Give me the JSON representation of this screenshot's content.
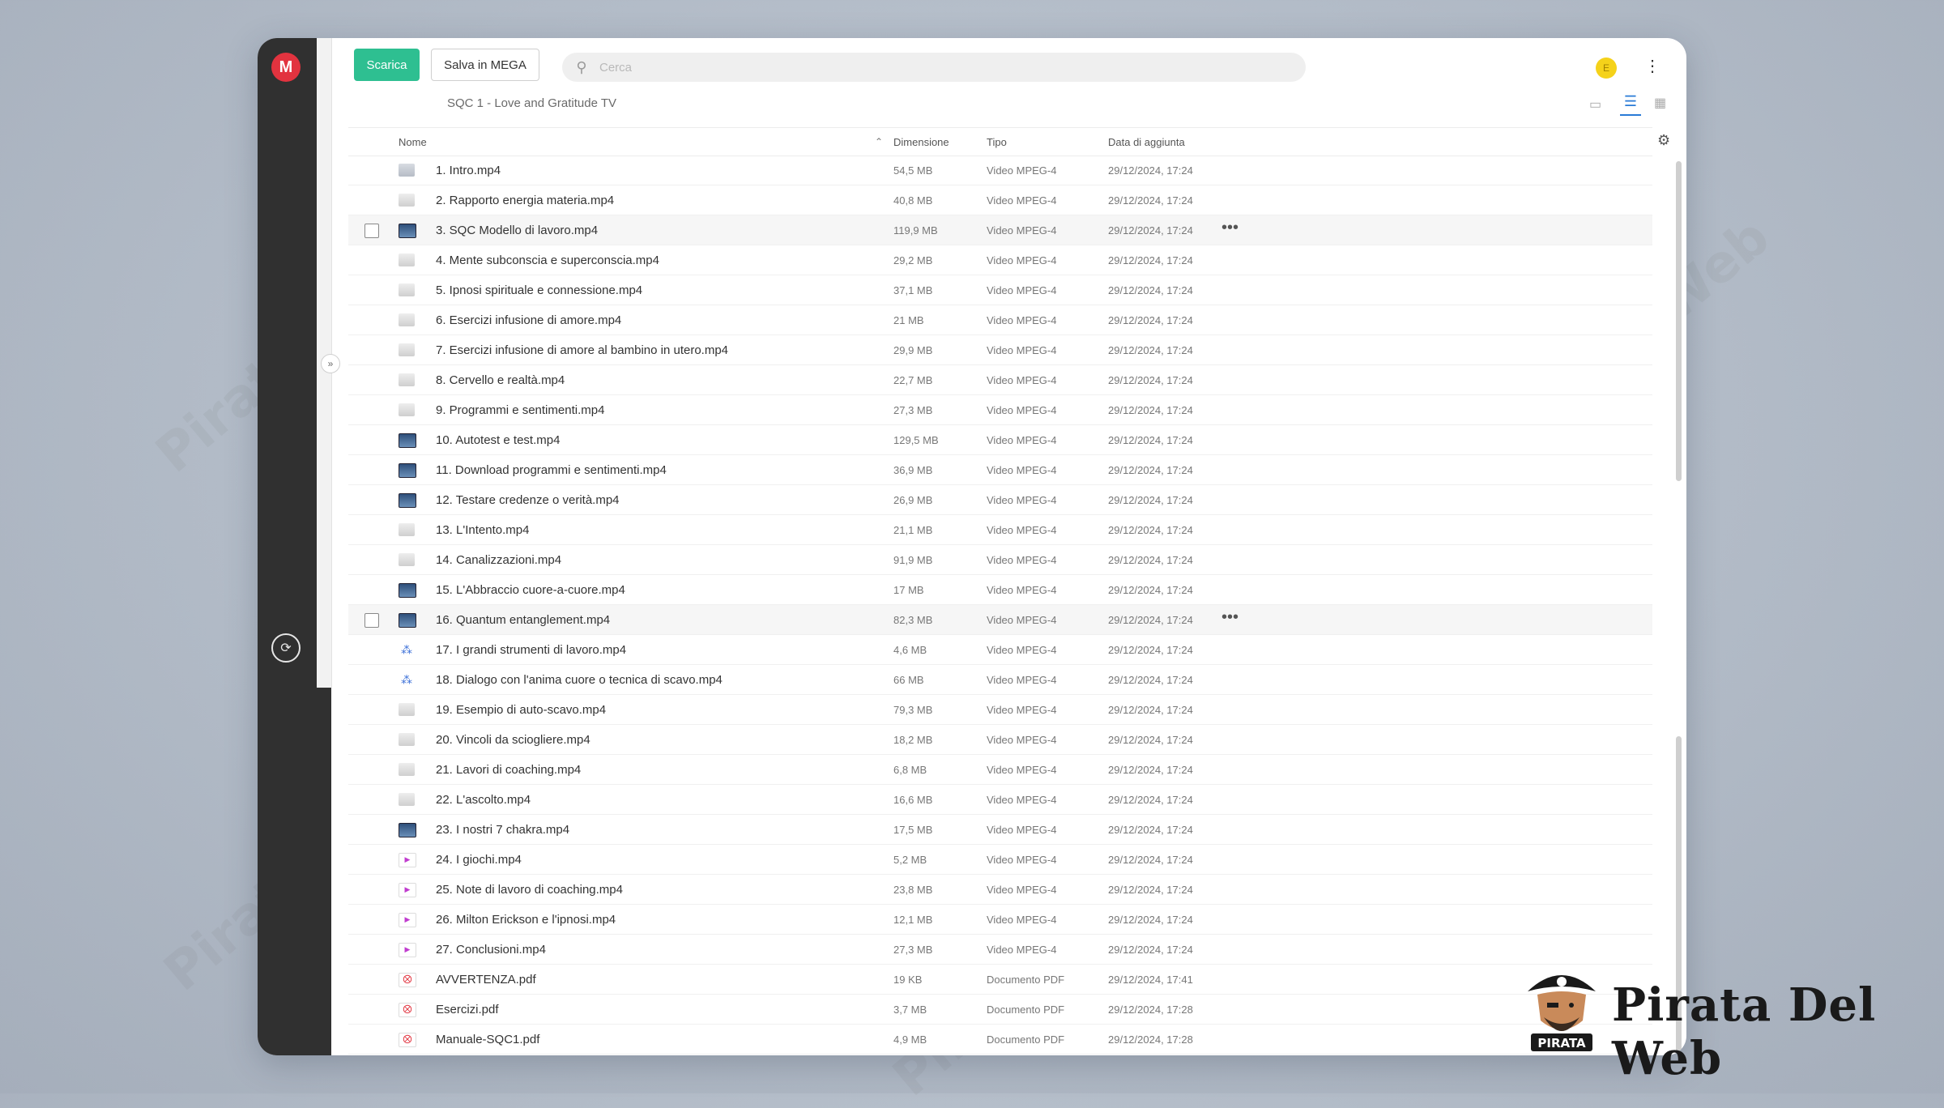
{
  "toolbar": {
    "download_label": "Scarica",
    "save_label": "Salva in MEGA",
    "search_placeholder": "Cerca",
    "avatar_initial": "E"
  },
  "breadcrumb": "SQC 1 - Love and Gratitude TV",
  "table": {
    "headers": {
      "name": "Nome",
      "size": "Dimensione",
      "type": "Tipo",
      "date": "Data di aggiunta"
    },
    "rows": [
      {
        "name": "1. Intro.mp4",
        "size": "54,5 MB",
        "type": "Video MPEG-4",
        "date": "29/12/2024, 17:24",
        "thumb": "t-video"
      },
      {
        "name": "2. Rapporto energia materia.mp4",
        "size": "40,8 MB",
        "type": "Video MPEG-4",
        "date": "29/12/2024, 17:24",
        "thumb": "t-light"
      },
      {
        "name": "3. SQC Modello di lavoro.mp4",
        "size": "119,9 MB",
        "type": "Video MPEG-4",
        "date": "29/12/2024, 17:24",
        "thumb": "t-dark",
        "hover": true
      },
      {
        "name": "4. Mente subconscia e superconscia.mp4",
        "size": "29,2 MB",
        "type": "Video MPEG-4",
        "date": "29/12/2024, 17:24",
        "thumb": "t-light"
      },
      {
        "name": "5. Ipnosi spirituale e connessione.mp4",
        "size": "37,1 MB",
        "type": "Video MPEG-4",
        "date": "29/12/2024, 17:24",
        "thumb": "t-light"
      },
      {
        "name": "6. Esercizi infusione di amore.mp4",
        "size": "21 MB",
        "type": "Video MPEG-4",
        "date": "29/12/2024, 17:24",
        "thumb": "t-light"
      },
      {
        "name": "7. Esercizi infusione di amore al bambino in utero.mp4",
        "size": "29,9 MB",
        "type": "Video MPEG-4",
        "date": "29/12/2024, 17:24",
        "thumb": "t-light"
      },
      {
        "name": "8. Cervello e realtà.mp4",
        "size": "22,7 MB",
        "type": "Video MPEG-4",
        "date": "29/12/2024, 17:24",
        "thumb": "t-light"
      },
      {
        "name": "9. Programmi e sentimenti.mp4",
        "size": "27,3 MB",
        "type": "Video MPEG-4",
        "date": "29/12/2024, 17:24",
        "thumb": "t-light"
      },
      {
        "name": "10. Autotest e test.mp4",
        "size": "129,5 MB",
        "type": "Video MPEG-4",
        "date": "29/12/2024, 17:24",
        "thumb": "t-dark"
      },
      {
        "name": "11. Download programmi e sentimenti.mp4",
        "size": "36,9 MB",
        "type": "Video MPEG-4",
        "date": "29/12/2024, 17:24",
        "thumb": "t-dark"
      },
      {
        "name": "12. Testare credenze o verità.mp4",
        "size": "26,9 MB",
        "type": "Video MPEG-4",
        "date": "29/12/2024, 17:24",
        "thumb": "t-dark"
      },
      {
        "name": "13. L'Intento.mp4",
        "size": "21,1 MB",
        "type": "Video MPEG-4",
        "date": "29/12/2024, 17:24",
        "thumb": "t-light"
      },
      {
        "name": "14. Canalizzazioni.mp4",
        "size": "91,9 MB",
        "type": "Video MPEG-4",
        "date": "29/12/2024, 17:24",
        "thumb": "t-light"
      },
      {
        "name": "15. L'Abbraccio cuore-a-cuore.mp4",
        "size": "17 MB",
        "type": "Video MPEG-4",
        "date": "29/12/2024, 17:24",
        "thumb": "t-dark"
      },
      {
        "name": "16. Quantum entanglement.mp4",
        "size": "82,3 MB",
        "type": "Video MPEG-4",
        "date": "29/12/2024, 17:24",
        "thumb": "t-dark",
        "hover": true
      },
      {
        "name": "17. I grandi strumenti di lavoro.mp4",
        "size": "4,6 MB",
        "type": "Video MPEG-4",
        "date": "29/12/2024, 17:24",
        "thumb": "t-net"
      },
      {
        "name": "18. Dialogo con l'anima cuore o tecnica di scavo.mp4",
        "size": "66 MB",
        "type": "Video MPEG-4",
        "date": "29/12/2024, 17:24",
        "thumb": "t-net"
      },
      {
        "name": "19. Esempio di auto-scavo.mp4",
        "size": "79,3 MB",
        "type": "Video MPEG-4",
        "date": "29/12/2024, 17:24",
        "thumb": "t-light"
      },
      {
        "name": "20. Vincoli da sciogliere.mp4",
        "size": "18,2 MB",
        "type": "Video MPEG-4",
        "date": "29/12/2024, 17:24",
        "thumb": "t-light"
      },
      {
        "name": "21. Lavori di coaching.mp4",
        "size": "6,8 MB",
        "type": "Video MPEG-4",
        "date": "29/12/2024, 17:24",
        "thumb": "t-light"
      },
      {
        "name": "22. L'ascolto.mp4",
        "size": "16,6 MB",
        "type": "Video MPEG-4",
        "date": "29/12/2024, 17:24",
        "thumb": "t-light"
      },
      {
        "name": "23. I nostri 7 chakra.mp4",
        "size": "17,5 MB",
        "type": "Video MPEG-4",
        "date": "29/12/2024, 17:24",
        "thumb": "t-dark"
      },
      {
        "name": "24. I giochi.mp4",
        "size": "5,2 MB",
        "type": "Video MPEG-4",
        "date": "29/12/2024, 17:24",
        "thumb": "t-mp4"
      },
      {
        "name": "25. Note di lavoro di coaching.mp4",
        "size": "23,8 MB",
        "type": "Video MPEG-4",
        "date": "29/12/2024, 17:24",
        "thumb": "t-mp4"
      },
      {
        "name": "26. Milton Erickson e l'ipnosi.mp4",
        "size": "12,1 MB",
        "type": "Video MPEG-4",
        "date": "29/12/2024, 17:24",
        "thumb": "t-mp4"
      },
      {
        "name": "27. Conclusioni.mp4",
        "size": "27,3 MB",
        "type": "Video MPEG-4",
        "date": "29/12/2024, 17:24",
        "thumb": "t-mp4"
      },
      {
        "name": "AVVERTENZA.pdf",
        "size": "19 KB",
        "type": "Documento PDF",
        "date": "29/12/2024, 17:41",
        "thumb": "t-pdf"
      },
      {
        "name": "Esercizi.pdf",
        "size": "3,7 MB",
        "type": "Documento PDF",
        "date": "29/12/2024, 17:28",
        "thumb": "t-pdf"
      },
      {
        "name": "Manuale-SQC1.pdf",
        "size": "4,9 MB",
        "type": "Documento PDF",
        "date": "29/12/2024, 17:28",
        "thumb": "t-pdf"
      }
    ]
  },
  "watermark": "Pirata Del Web",
  "brand": {
    "badge_text": "PIRATA",
    "name": "Pirata Del Web"
  },
  "colors": {
    "accent_green": "#2ebf91",
    "mega_red": "#e2333f",
    "rail_dark": "#303030",
    "link_blue": "#2a7bd7"
  }
}
